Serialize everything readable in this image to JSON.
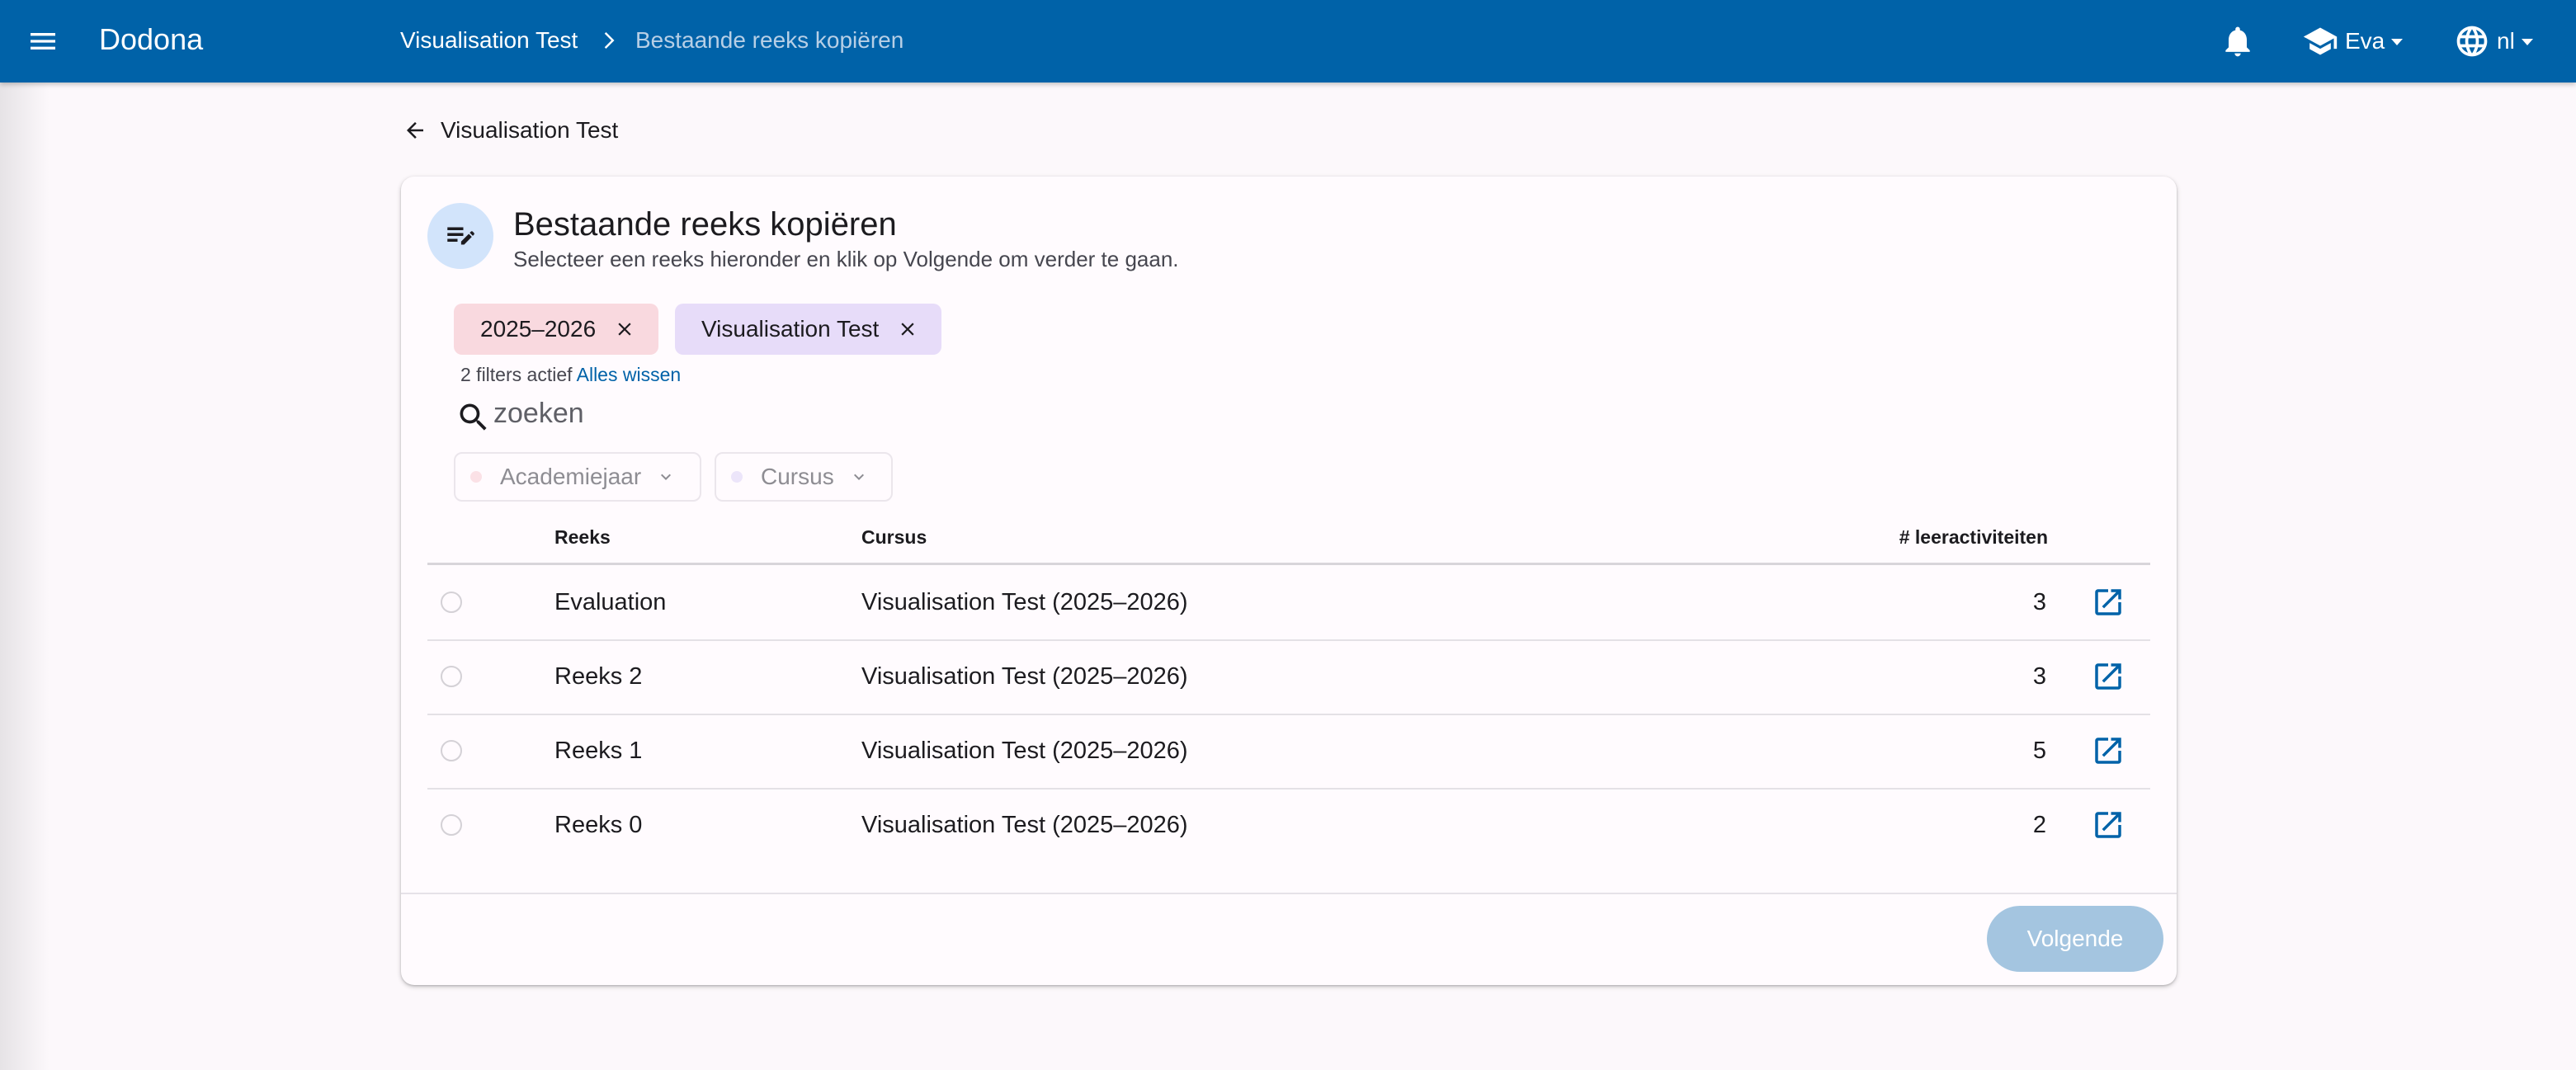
{
  "appbar": {
    "title": "Dodona",
    "breadcrumb": [
      "Visualisation Test",
      "Bestaande reeks kopiëren"
    ],
    "user": "Eva",
    "language": "nl"
  },
  "back_link": "Visualisation Test",
  "card": {
    "title": "Bestaande reeks kopiëren",
    "subtitle": "Selecteer een reeks hieronder en klik op Volgende om verder te gaan.",
    "chips": [
      "2025–2026",
      "Visualisation Test"
    ],
    "filter_count": "2 filters actief",
    "clear_all": "Alles wissen",
    "search_placeholder": "zoeken",
    "dropdowns": [
      "Academiejaar",
      "Cursus"
    ],
    "table": {
      "headers": [
        "Reeks",
        "Cursus",
        "# leeractiviteiten"
      ],
      "rows": [
        {
          "name": "Evaluation",
          "course": "Visualisation Test (2025–2026)",
          "count": "3"
        },
        {
          "name": "Reeks 2",
          "course": "Visualisation Test (2025–2026)",
          "count": "3"
        },
        {
          "name": "Reeks 1",
          "course": "Visualisation Test (2025–2026)",
          "count": "5"
        },
        {
          "name": "Reeks 0",
          "course": "Visualisation Test (2025–2026)",
          "count": "2"
        }
      ]
    },
    "next_button": "Volgende"
  },
  "colors": {
    "primary": "#0062a8",
    "chip_year": "#f9d9df",
    "chip_course": "#e7dcf9",
    "button_disabled": "#a4c5e0"
  }
}
